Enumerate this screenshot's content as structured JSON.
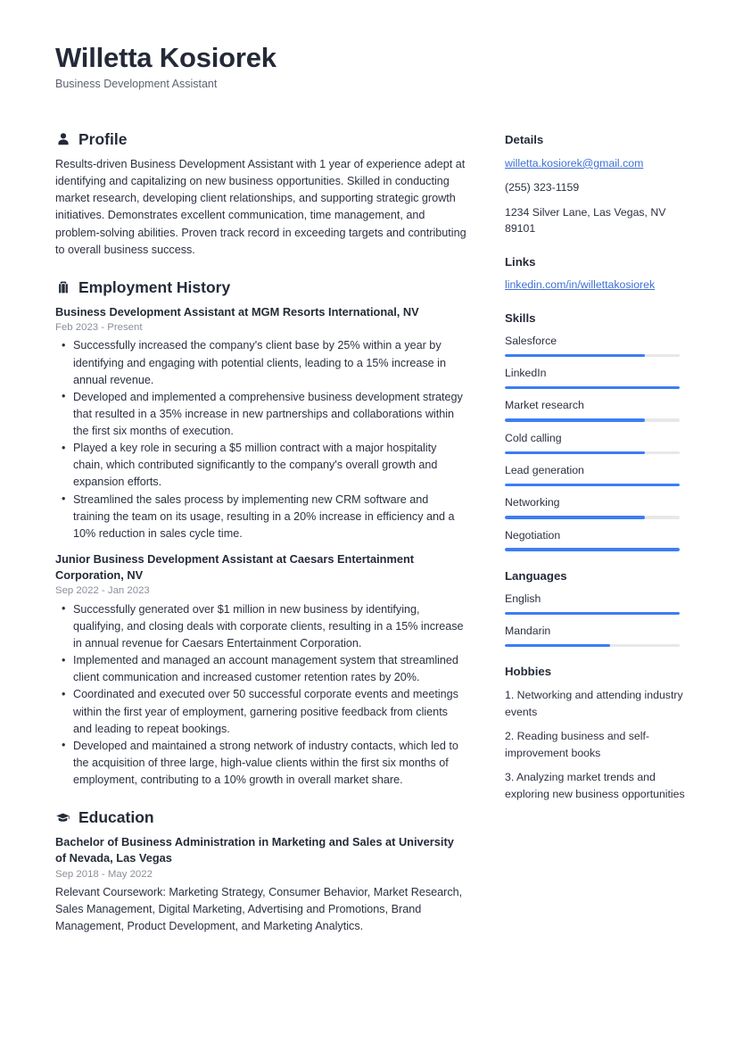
{
  "header": {
    "name": "Willetta Kosiorek",
    "title": "Business Development Assistant"
  },
  "sections": {
    "profile": {
      "icon": "user-icon",
      "title": "Profile",
      "text": "Results-driven Business Development Assistant with 1 year of experience adept at identifying and capitalizing on new business opportunities. Skilled in conducting market research, developing client relationships, and supporting strategic growth initiatives. Demonstrates excellent communication, time management, and problem-solving abilities. Proven track record in exceeding targets and contributing to overall business success."
    },
    "employment": {
      "icon": "briefcase-icon",
      "title": "Employment History",
      "entries": [
        {
          "title": "Business Development Assistant at MGM Resorts International, NV",
          "date": "Feb 2023 - Present",
          "bullets": [
            "Successfully increased the company's client base by 25% within a year by identifying and engaging with potential clients, leading to a 15% increase in annual revenue.",
            "Developed and implemented a comprehensive business development strategy that resulted in a 35% increase in new partnerships and collaborations within the first six months of execution.",
            "Played a key role in securing a $5 million contract with a major hospitality chain, which contributed significantly to the company's overall growth and expansion efforts.",
            "Streamlined the sales process by implementing new CRM software and training the team on its usage, resulting in a 20% increase in efficiency and a 10% reduction in sales cycle time."
          ]
        },
        {
          "title": "Junior Business Development Assistant at Caesars Entertainment Corporation, NV",
          "date": "Sep 2022 - Jan 2023",
          "bullets": [
            "Successfully generated over $1 million in new business by identifying, qualifying, and closing deals with corporate clients, resulting in a 15% increase in annual revenue for Caesars Entertainment Corporation.",
            "Implemented and managed an account management system that streamlined client communication and increased customer retention rates by 20%.",
            "Coordinated and executed over 50 successful corporate events and meetings within the first year of employment, garnering positive feedback from clients and leading to repeat bookings.",
            "Developed and maintained a strong network of industry contacts, which led to the acquisition of three large, high-value clients within the first six months of employment, contributing to a 10% growth in overall market share."
          ]
        }
      ]
    },
    "education": {
      "icon": "graduation-cap-icon",
      "title": "Education",
      "entries": [
        {
          "title": "Bachelor of Business Administration in Marketing and Sales at University of Nevada, Las Vegas",
          "date": "Sep 2018 - May 2022",
          "description": "Relevant Coursework: Marketing Strategy, Consumer Behavior, Market Research, Sales Management, Digital Marketing, Advertising and Promotions, Brand Management, Product Development, and Marketing Analytics."
        }
      ]
    }
  },
  "sidebar": {
    "details": {
      "title": "Details",
      "email": "willetta.kosiorek@gmail.com",
      "phone": "(255) 323-1159",
      "address": "1234 Silver Lane, Las Vegas, NV 89101"
    },
    "links": {
      "title": "Links",
      "items": [
        {
          "label": "linkedin.com/in/willettakosiorek"
        }
      ]
    },
    "skills": {
      "title": "Skills",
      "items": [
        {
          "label": "Salesforce",
          "level": 80
        },
        {
          "label": "LinkedIn",
          "level": 100
        },
        {
          "label": "Market research",
          "level": 80
        },
        {
          "label": "Cold calling",
          "level": 80
        },
        {
          "label": "Lead generation",
          "level": 100
        },
        {
          "label": "Networking",
          "level": 80
        },
        {
          "label": "Negotiation",
          "level": 100
        }
      ]
    },
    "languages": {
      "title": "Languages",
      "items": [
        {
          "label": "English",
          "level": 100
        },
        {
          "label": "Mandarin",
          "level": 60
        }
      ]
    },
    "hobbies": {
      "title": "Hobbies",
      "items": [
        "1. Networking and attending industry events",
        "2. Reading business and self-improvement books",
        "3. Analyzing market trends and exploring new business opportunities"
      ]
    }
  },
  "theme": {
    "accent": "#3d7df4",
    "link": "#3d6fd6",
    "heading": "#242a38",
    "text": "#2b3040",
    "muted": "#8a8f99",
    "track": "#e8e8ea"
  }
}
